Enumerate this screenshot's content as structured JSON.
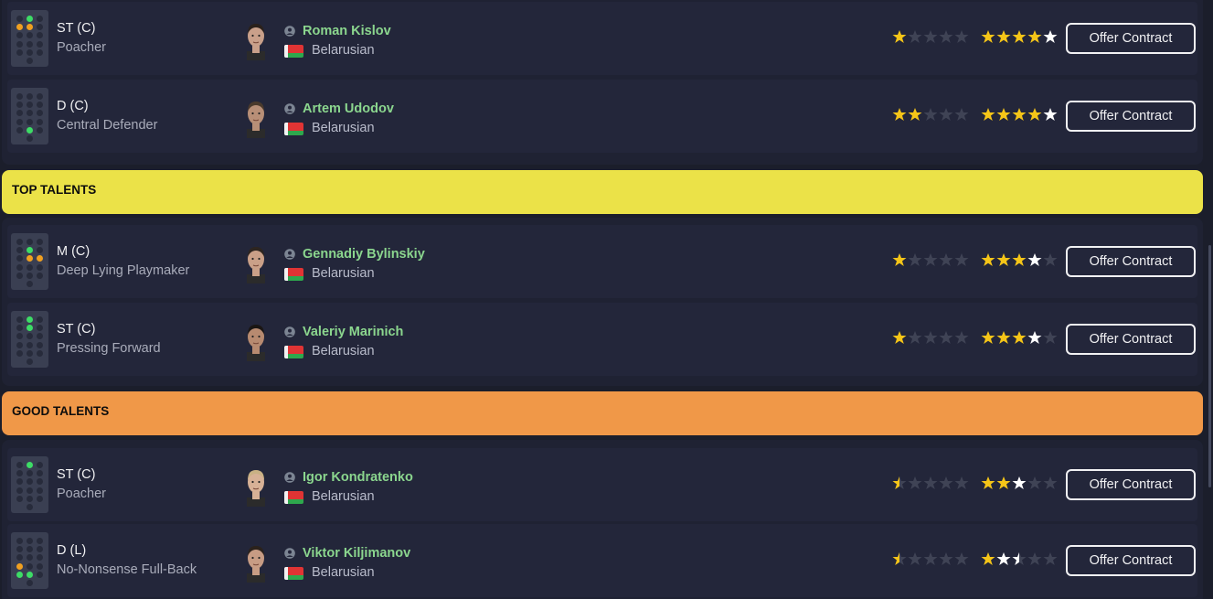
{
  "colors": {
    "top_talents": "#ebe248",
    "good_talents": "#f09848",
    "name_green": "#8bd68e",
    "star_gold": "#f5c518",
    "star_empty": "#3f4355"
  },
  "sections": {
    "top_talents": "TOP TALENTS",
    "good_talents": "GOOD TALENTS"
  },
  "players": [
    {
      "position": "ST (C)",
      "role": "Poacher",
      "name": "Roman Kislov",
      "nationality": "Belarusian",
      "current_ability_stars": 1,
      "potential_ability_stars": 5,
      "potential_white_from": 4.5,
      "button": "Offer Contract"
    },
    {
      "position": "D (C)",
      "role": "Central Defender",
      "name": "Artem Udodov",
      "nationality": "Belarusian",
      "current_ability_stars": 2,
      "potential_ability_stars": 5,
      "potential_white_from": 4.5,
      "button": "Offer Contract"
    },
    {
      "position": "M (C)",
      "role": "Deep Lying Playmaker",
      "name": "Gennadiy Bylinskiy",
      "nationality": "Belarusian",
      "current_ability_stars": 1,
      "potential_ability_stars": 4,
      "potential_white_from": 3.5,
      "button": "Offer Contract"
    },
    {
      "position": "ST (C)",
      "role": "Pressing Forward",
      "name": "Valeriy Marinich",
      "nationality": "Belarusian",
      "current_ability_stars": 1,
      "potential_ability_stars": 4,
      "potential_white_from": 3.5,
      "button": "Offer Contract"
    },
    {
      "position": "ST (C)",
      "role": "Poacher",
      "name": "Igor Kondratenko",
      "nationality": "Belarusian",
      "current_ability_stars": 0.5,
      "potential_ability_stars": 3,
      "potential_white_from": 2.5,
      "button": "Offer Contract"
    },
    {
      "position": "D (L)",
      "role": "No-Nonsense Full-Back",
      "name": "Viktor Kiljimanov",
      "nationality": "Belarusian",
      "current_ability_stars": 0.5,
      "potential_ability_stars": 2.5,
      "potential_white_from": 1.5,
      "button": "Offer Contract"
    }
  ],
  "icons": [
    "pitch-position-icon",
    "player-face-icon",
    "person-icon",
    "belarus-flag-icon",
    "star-icon"
  ]
}
